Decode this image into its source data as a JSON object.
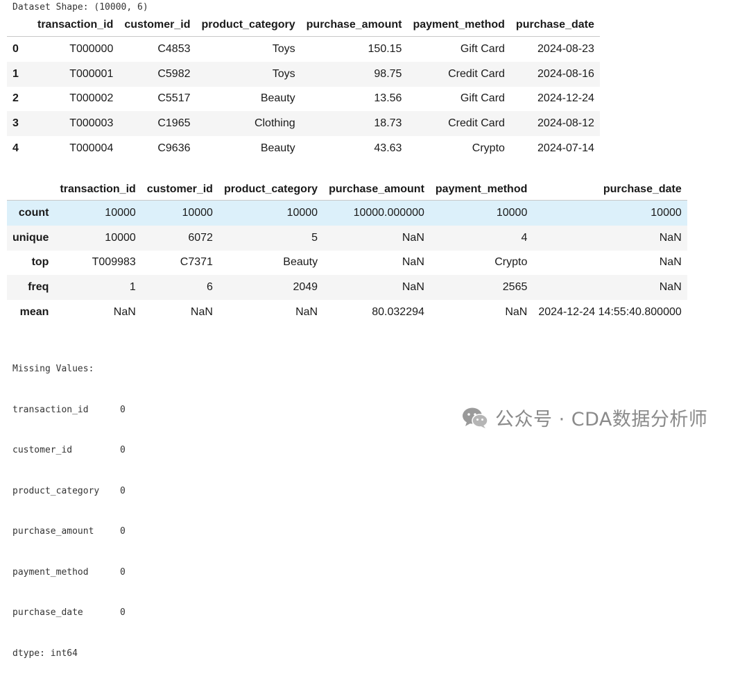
{
  "shape_line": "Dataset Shape: (10000, 6)",
  "head_table": {
    "columns": [
      "transaction_id",
      "customer_id",
      "product_category",
      "purchase_amount",
      "payment_method",
      "purchase_date"
    ],
    "rows": [
      {
        "index": "0",
        "cells": [
          "T000000",
          "C4853",
          "Toys",
          "150.15",
          "Gift Card",
          "2024-08-23"
        ]
      },
      {
        "index": "1",
        "cells": [
          "T000001",
          "C5982",
          "Toys",
          "98.75",
          "Credit Card",
          "2024-08-16"
        ]
      },
      {
        "index": "2",
        "cells": [
          "T000002",
          "C5517",
          "Beauty",
          "13.56",
          "Gift Card",
          "2024-12-24"
        ]
      },
      {
        "index": "3",
        "cells": [
          "T000003",
          "C1965",
          "Clothing",
          "18.73",
          "Credit Card",
          "2024-08-12"
        ]
      },
      {
        "index": "4",
        "cells": [
          "T000004",
          "C9636",
          "Beauty",
          "43.63",
          "Crypto",
          "2024-07-14"
        ]
      }
    ]
  },
  "describe_table": {
    "columns": [
      "transaction_id",
      "customer_id",
      "product_category",
      "purchase_amount",
      "payment_method",
      "purchase_date"
    ],
    "rows": [
      {
        "index": "count",
        "cells": [
          "10000",
          "10000",
          "10000",
          "10000.000000",
          "10000",
          "10000"
        ]
      },
      {
        "index": "unique",
        "cells": [
          "10000",
          "6072",
          "5",
          "NaN",
          "4",
          "NaN"
        ]
      },
      {
        "index": "top",
        "cells": [
          "T009983",
          "C7371",
          "Beauty",
          "NaN",
          "Crypto",
          "NaN"
        ]
      },
      {
        "index": "freq",
        "cells": [
          "1",
          "6",
          "2049",
          "NaN",
          "2565",
          "NaN"
        ]
      },
      {
        "index": "mean",
        "cells": [
          "NaN",
          "NaN",
          "NaN",
          "80.032294",
          "NaN",
          "2024-12-24 14:55:40.800000"
        ]
      }
    ]
  },
  "missing_values": {
    "title": "Missing Values:",
    "items": [
      {
        "name": "transaction_id",
        "value": "0"
      },
      {
        "name": "customer_id",
        "value": "0"
      },
      {
        "name": "product_category",
        "value": "0"
      },
      {
        "name": "purchase_amount",
        "value": "0"
      },
      {
        "name": "payment_method",
        "value": "0"
      },
      {
        "name": "purchase_date",
        "value": "0"
      }
    ],
    "dtype_line": "dtype: int64"
  },
  "watermark": {
    "text": "公众号 · CDA数据分析师",
    "icon": "wechat-icon"
  }
}
